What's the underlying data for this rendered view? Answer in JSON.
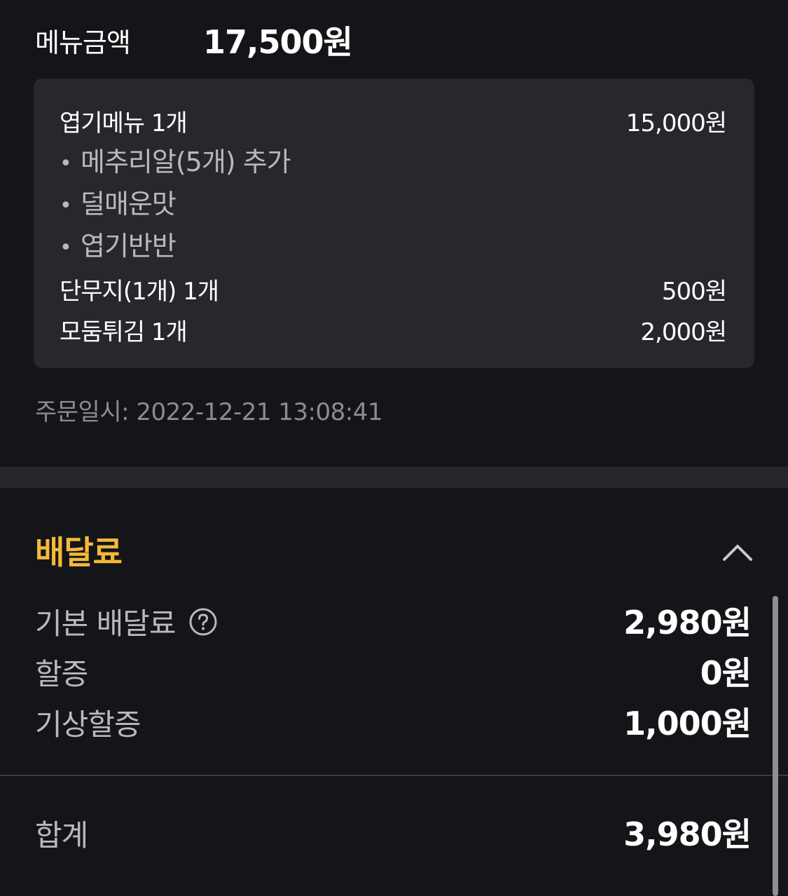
{
  "menu_total": {
    "label": "메뉴금액",
    "value": "17,500원"
  },
  "order_items": [
    {
      "name": "엽기메뉴 1개",
      "price": "15,000원"
    },
    {
      "name": "단무지(1개) 1개",
      "price": "500원"
    },
    {
      "name": "모둠튀김 1개",
      "price": "2,000원"
    }
  ],
  "options": [
    "메추리알(5개) 추가",
    "덜매운맛",
    "엽기반반"
  ],
  "bullet": "•",
  "order_date": "주문일시: 2022-12-21 13:08:41",
  "delivery": {
    "title": "배달료",
    "accent_color": "#f5b93a",
    "collapse_icon": "chevron-up-icon",
    "rows": [
      {
        "label": "기본 배달료",
        "value": "2,980원",
        "help_icon": "question-circle-icon"
      },
      {
        "label": "할증",
        "value": "0원"
      },
      {
        "label": "기상할증",
        "value": "1,000원"
      }
    ],
    "total_label": "합계",
    "total_value": "3,980원"
  }
}
